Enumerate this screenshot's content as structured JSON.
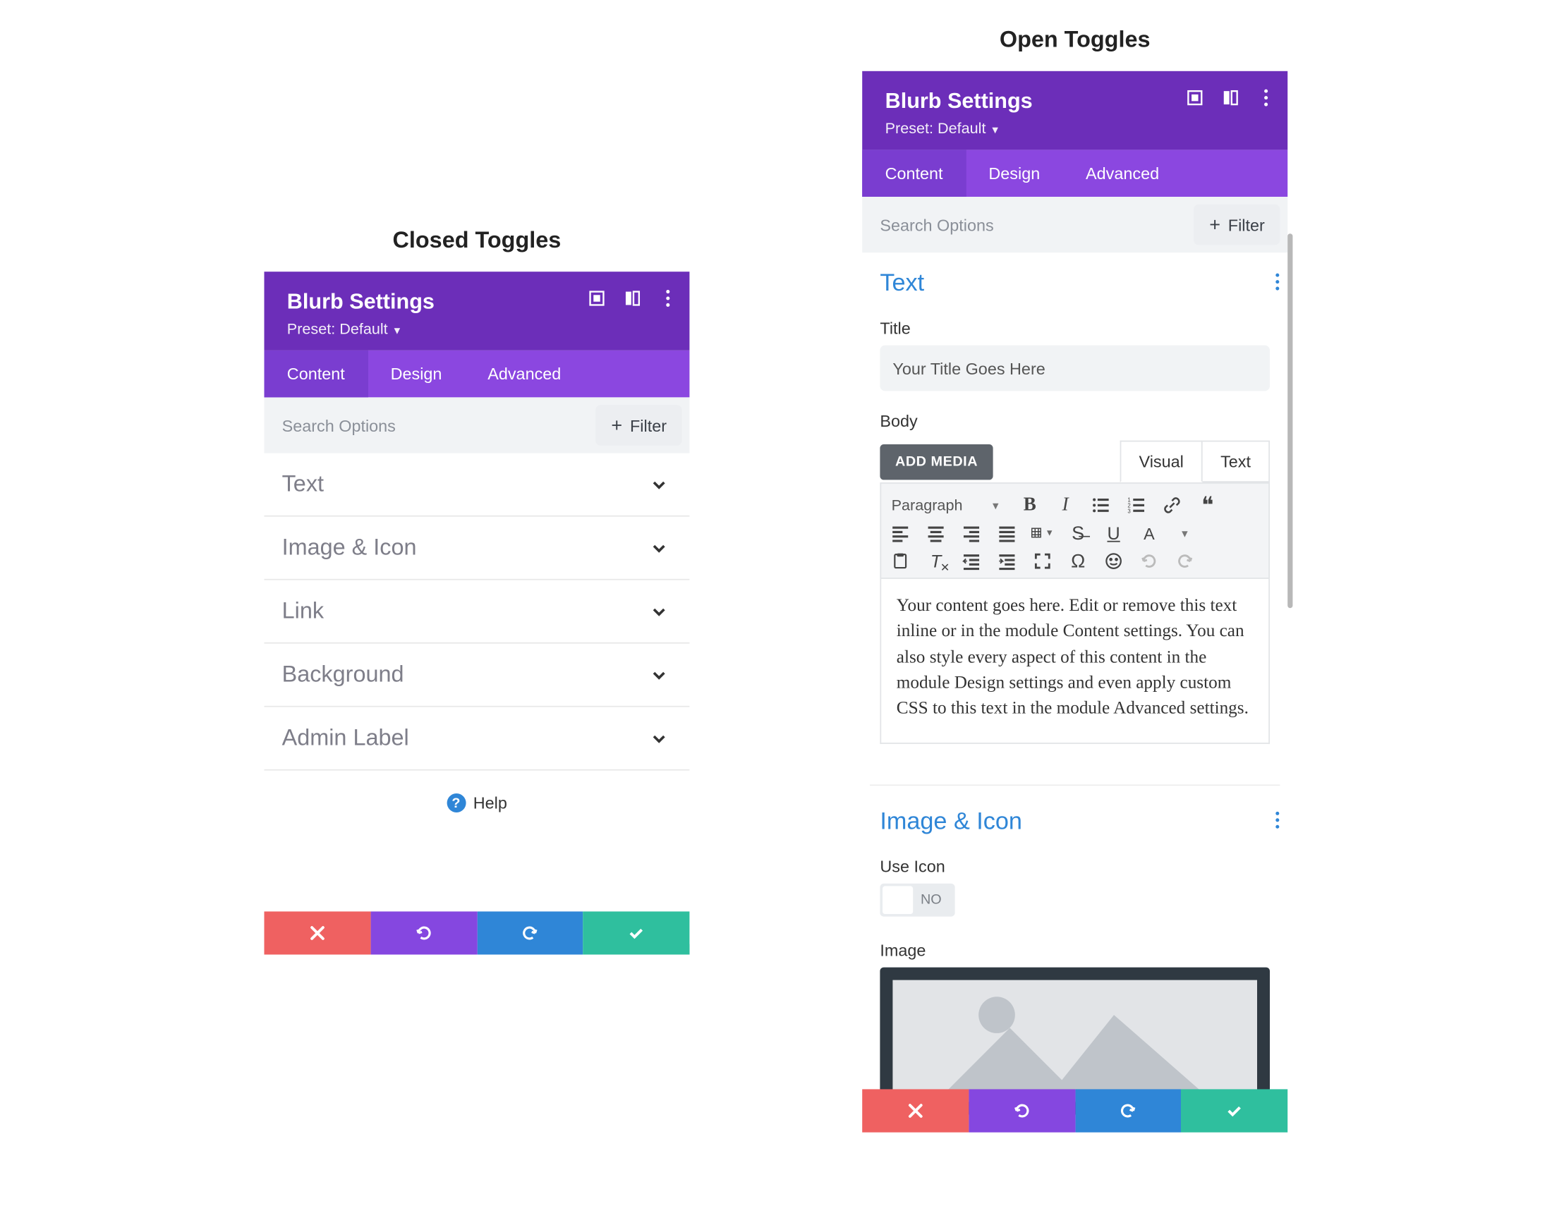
{
  "headings": {
    "closed": "Closed Toggles",
    "open": "Open Toggles"
  },
  "panel": {
    "title": "Blurb Settings",
    "preset_label": "Preset:",
    "preset_value": "Default",
    "tabs": {
      "content": "Content",
      "design": "Design",
      "advanced": "Advanced"
    },
    "search_placeholder": "Search Options",
    "filter_label": "Filter"
  },
  "closed_toggles": [
    {
      "label": "Text"
    },
    {
      "label": "Image & Icon"
    },
    {
      "label": "Link"
    },
    {
      "label": "Background"
    },
    {
      "label": "Admin Label"
    }
  ],
  "help_label": "Help",
  "footer": {
    "cancel": "cancel",
    "undo": "undo",
    "redo": "redo",
    "confirm": "confirm"
  },
  "open_panel": {
    "text_section": {
      "title": "Text",
      "title_label": "Title",
      "title_value": "Your Title Goes Here",
      "body_label": "Body",
      "add_media": "ADD MEDIA",
      "visual_tab": "Visual",
      "text_tab": "Text",
      "format_dropdown": "Paragraph",
      "body_content": "Your content goes here. Edit or remove this text inline or in the module Content settings. You can also style every aspect of this content in the module Design settings and even apply custom CSS to this text in the module Advanced settings."
    },
    "image_section": {
      "title": "Image & Icon",
      "use_icon_label": "Use Icon",
      "use_icon_value": "NO",
      "image_label": "Image"
    }
  },
  "colors": {
    "purple_dark": "#6c2eb9",
    "purple_mid": "#8547e0",
    "blue": "#2f86d7",
    "green": "#2fbf9e",
    "red": "#ef6161"
  }
}
